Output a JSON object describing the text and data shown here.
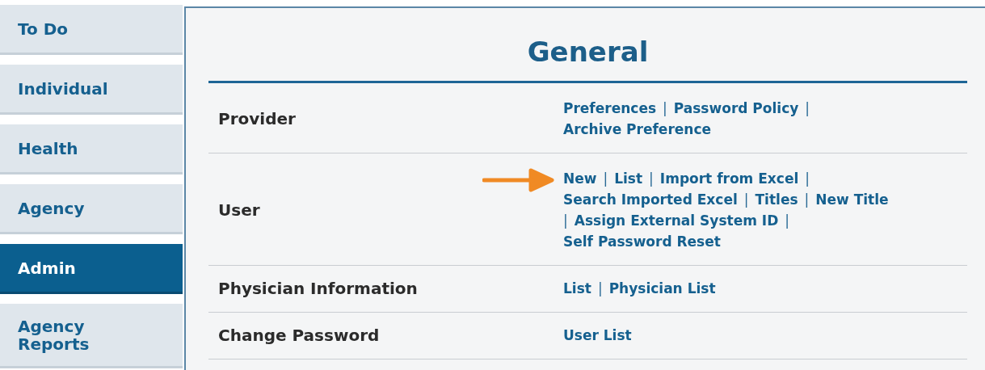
{
  "sidebar": {
    "items": [
      {
        "label": "To Do",
        "selected": false
      },
      {
        "label": "Individual",
        "selected": false
      },
      {
        "label": "Health",
        "selected": false
      },
      {
        "label": "Agency",
        "selected": false
      },
      {
        "label": "Admin",
        "selected": true
      },
      {
        "label": "Agency Reports",
        "selected": false
      }
    ]
  },
  "panel": {
    "title": "General",
    "rows": [
      {
        "label": "Provider",
        "pointer": false,
        "lines": [
          [
            {
              "kind": "link",
              "text": "Preferences"
            },
            {
              "kind": "sep",
              "text": "|"
            },
            {
              "kind": "link",
              "text": "Password Policy"
            },
            {
              "kind": "sep",
              "text": "|"
            }
          ],
          [
            {
              "kind": "link",
              "text": "Archive Preference"
            }
          ]
        ]
      },
      {
        "label": "User",
        "pointer": true,
        "lines": [
          [
            {
              "kind": "link",
              "text": "New"
            },
            {
              "kind": "sep",
              "text": "|"
            },
            {
              "kind": "link",
              "text": "List"
            },
            {
              "kind": "sep",
              "text": "|"
            },
            {
              "kind": "link",
              "text": "Import from Excel"
            },
            {
              "kind": "sep",
              "text": "|"
            }
          ],
          [
            {
              "kind": "link",
              "text": "Search Imported Excel"
            },
            {
              "kind": "sep",
              "text": "|"
            },
            {
              "kind": "link",
              "text": "Titles"
            },
            {
              "kind": "sep",
              "text": "|"
            },
            {
              "kind": "link",
              "text": "New Title"
            }
          ],
          [
            {
              "kind": "sep",
              "text": "|"
            },
            {
              "kind": "link",
              "text": "Assign External System ID"
            },
            {
              "kind": "sep",
              "text": "|"
            }
          ],
          [
            {
              "kind": "link",
              "text": "Self Password Reset"
            }
          ]
        ]
      },
      {
        "label": "Physician Information",
        "pointer": false,
        "lines": [
          [
            {
              "kind": "link",
              "text": "List"
            },
            {
              "kind": "sep",
              "text": "|"
            },
            {
              "kind": "link",
              "text": "Physician List"
            }
          ]
        ]
      },
      {
        "label": "Change Password",
        "pointer": false,
        "lines": [
          [
            {
              "kind": "link",
              "text": "User List"
            }
          ]
        ]
      }
    ]
  }
}
